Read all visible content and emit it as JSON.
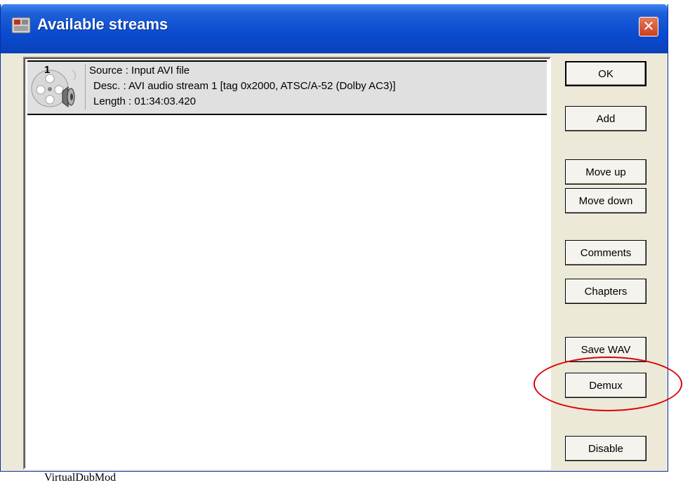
{
  "window": {
    "title": "Available streams",
    "close_glyph": "✕"
  },
  "stream_list": {
    "rows": [
      {
        "index": "1",
        "source": "Source : Input AVI file",
        "desc": "Desc. : AVI audio stream 1 [tag 0x2000, ATSC/A-52 (Dolby AC3)]",
        "length": "Length : 01:34:03.420",
        "icon": "film-reel-speaker-icon"
      }
    ]
  },
  "buttons": {
    "ok": "OK",
    "add": "Add",
    "move_up": "Move up",
    "move_down": "Move down",
    "comments": "Comments",
    "chapters": "Chapters",
    "save_wav": "Save WAV",
    "demux": "Demux",
    "disable": "Disable"
  },
  "annotation": {
    "target": "Demux",
    "color": "#e00000"
  },
  "caption": "VirtualDubMod",
  "colors": {
    "titlebar": "#0a4bd0",
    "dialog_bg": "#ece9d8",
    "close_button": "#c9401e",
    "selected_row": "#e0e0e0"
  }
}
